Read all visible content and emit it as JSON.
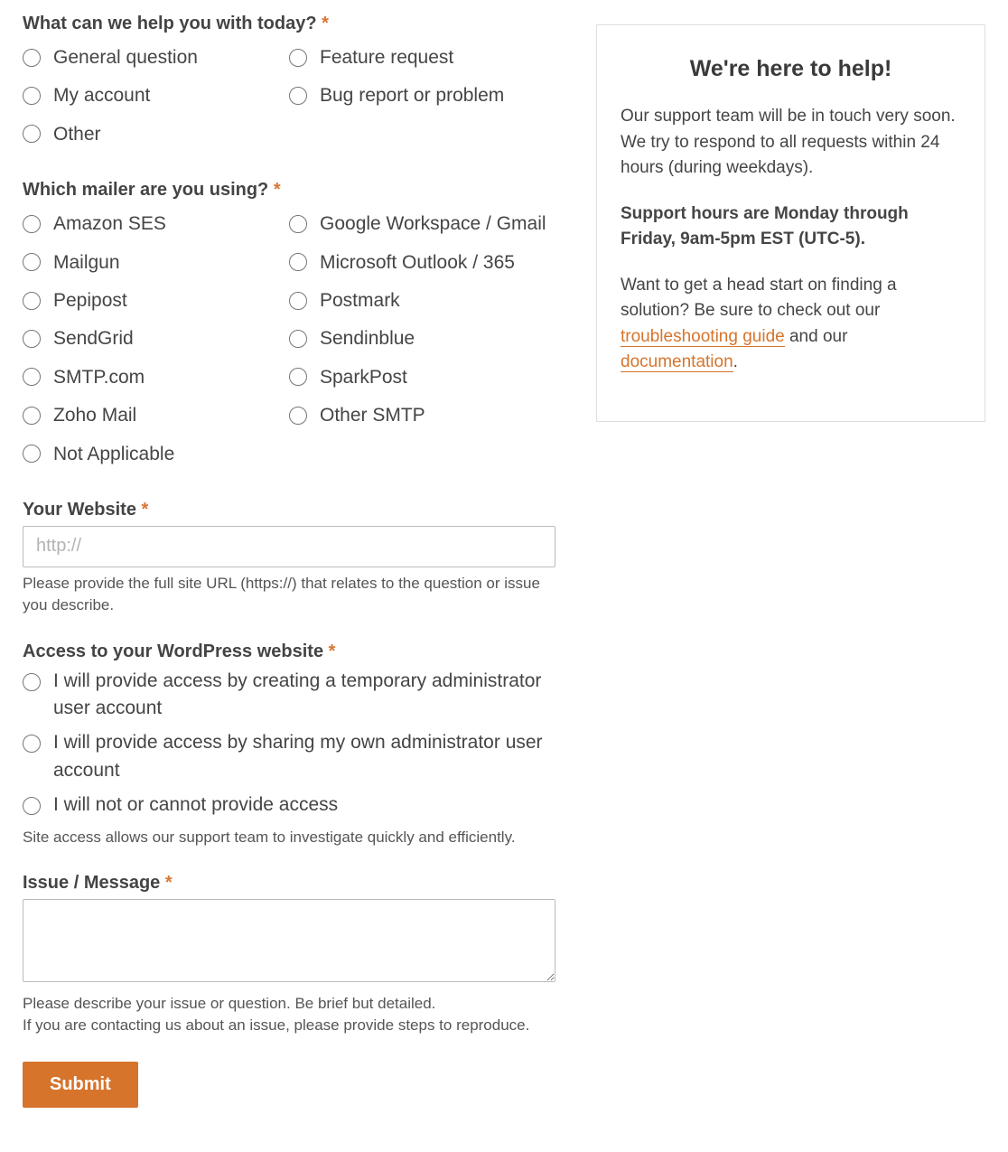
{
  "q1": {
    "label": "What can we help you with today?",
    "options": [
      "General question",
      "Feature request",
      "My account",
      "Bug report or problem",
      "Other"
    ]
  },
  "q2": {
    "label": "Which mailer are you using?",
    "options": [
      "Amazon SES",
      "Google Workspace / Gmail",
      "Mailgun",
      "Microsoft Outlook / 365",
      "Pepipost",
      "Postmark",
      "SendGrid",
      "Sendinblue",
      "SMTP.com",
      "SparkPost",
      "Zoho Mail",
      "Other SMTP",
      "Not Applicable"
    ]
  },
  "website": {
    "label": "Your Website",
    "placeholder": "http://",
    "help": "Please provide the full site URL (https://) that relates to the question or issue you describe."
  },
  "access": {
    "label": "Access to your WordPress website",
    "options": [
      "I will provide access by creating a temporary administrator user account",
      "I will provide access by sharing my own administrator user account",
      "I will not or cannot provide access"
    ],
    "help": "Site access allows our support team to investigate quickly and efficiently."
  },
  "issue": {
    "label": "Issue / Message",
    "help1": "Please describe your issue or question. Be brief but detailed.",
    "help2": "If you are contacting us about an issue, please provide steps to reproduce."
  },
  "submit": "Submit",
  "sidebar": {
    "title": "We're here to help!",
    "p1": "Our support team will be in touch very soon. We try to respond to all requests within 24 hours (during weekdays).",
    "p2": "Support hours are Monday through Friday, 9am-5pm EST (UTC-5).",
    "p3_a": "Want to get a head start on finding a solution? Be sure to check out our ",
    "p3_link1": "troubleshooting guide",
    "p3_b": " and our ",
    "p3_link2": "documentation",
    "p3_c": "."
  },
  "required_mark": "*"
}
